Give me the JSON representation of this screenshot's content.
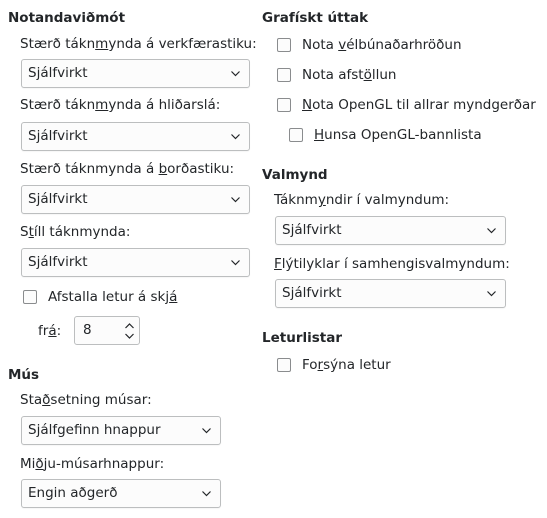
{
  "ui": {
    "left": {
      "title": "Notandaviðmót",
      "toolbar_label": {
        "pre": "Stærð tákn",
        "u": "m",
        "post": "ynda á verkfærastiku:"
      },
      "toolbar_value": "Sjálfvirkt",
      "sidebar_label": {
        "pre": "Stærð tákn",
        "u": "m",
        "post": "ynda á hliðarslá:"
      },
      "sidebar_value": "Sjálfvirkt",
      "notebookbar_label": {
        "pre": "Stærð táknmynda á ",
        "u": "b",
        "post": "orðastiku:"
      },
      "notebookbar_value": "Sjálfvirkt",
      "style_label": {
        "pre": "S",
        "u": "t",
        "post": "íll táknmynda:"
      },
      "style_value": "Sjálfvirkt",
      "antialias_label": {
        "pre": "Afstalla letur á skj",
        "u": "á",
        "post": ""
      },
      "from_label": {
        "pre": "fr",
        "u": "á",
        "post": ":"
      },
      "from_value": "8"
    },
    "mouse": {
      "title": "Mús",
      "position_label": {
        "pre": "Sta",
        "u": "ð",
        "post": "setning músar:"
      },
      "position_value": "Sjálfgefinn hnappur",
      "middle_label": {
        "pre": "Mi",
        "u": "ð",
        "post": "ju-músarhnappur:"
      },
      "middle_value": "Engin aðgerð"
    },
    "graphics": {
      "title": "Grafískt úttak",
      "hw_accel": {
        "pre": "Nota ",
        "u": "v",
        "post": "élbúnaðarhröðun"
      },
      "antialiasing": {
        "pre": "Nota afst",
        "u": "ö",
        "post": "llun"
      },
      "opengl": {
        "pre": "",
        "u": "N",
        "post": "ota OpenGL til allrar myndgerðar"
      },
      "opengl_blacklist": {
        "pre": "",
        "u": "H",
        "post": "unsa OpenGL-bannlista"
      }
    },
    "menu": {
      "title": "Valmynd",
      "icons_label": {
        "pre": "Táknm",
        "u": "y",
        "post": "ndir í valmyndum:"
      },
      "icons_value": "Sjálfvirkt",
      "shortcuts_label": {
        "pre": "",
        "u": "F",
        "post": "lýtilyklar í samhengisvalmyndum:"
      },
      "shortcuts_value": "Sjálfvirkt"
    },
    "fontlists": {
      "title": "Leturlistar",
      "preview": {
        "pre": "Fo",
        "u": "r",
        "post": "sýna letur"
      }
    }
  }
}
